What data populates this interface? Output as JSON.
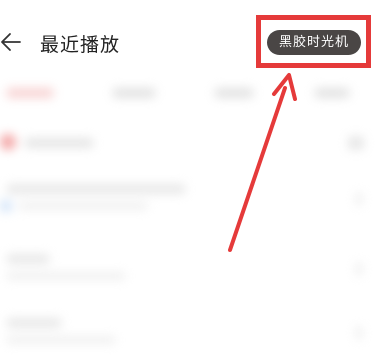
{
  "header": {
    "title": "最近播放",
    "back_icon": "back-arrow-icon"
  },
  "vinyl_button": {
    "label": "黑胶时光机"
  },
  "annotation": {
    "color": "#e53a3a"
  }
}
